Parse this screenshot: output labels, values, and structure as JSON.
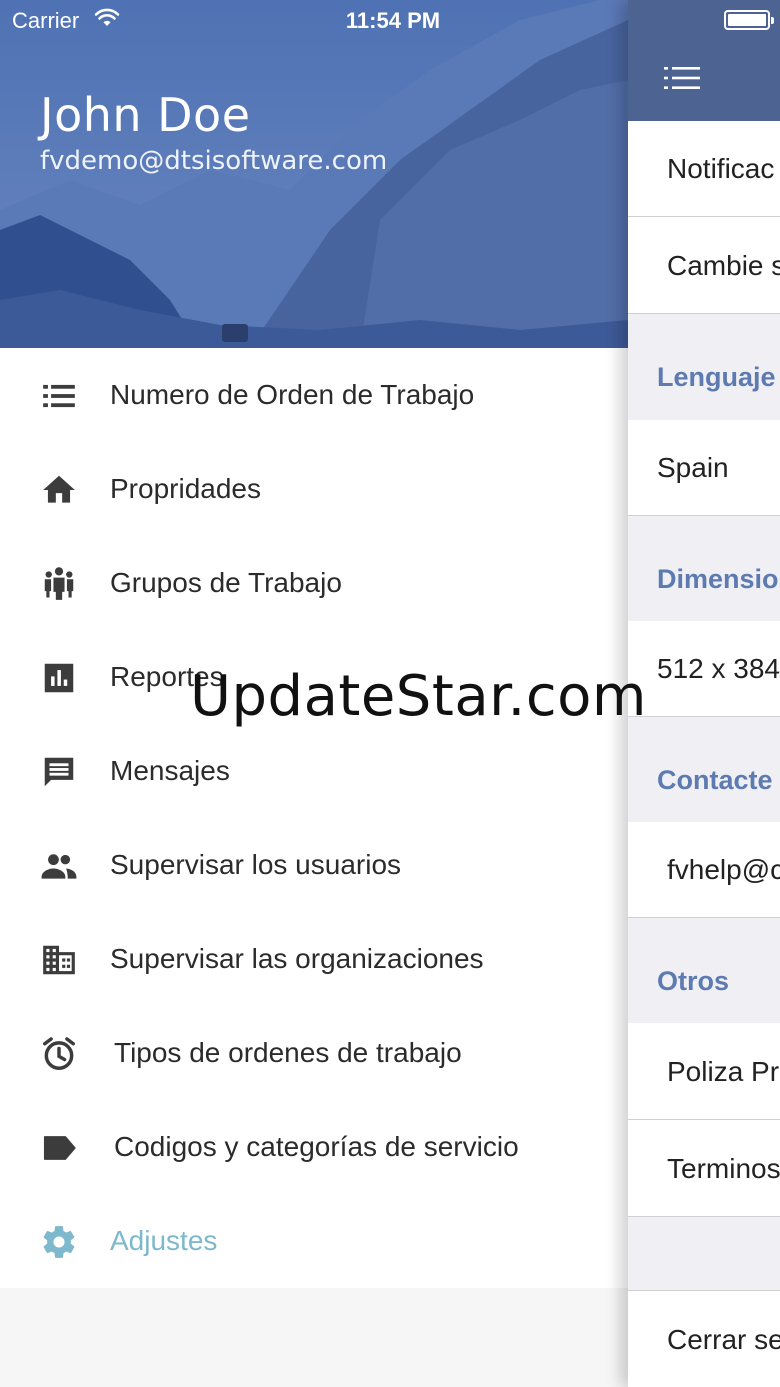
{
  "status_bar": {
    "carrier": "Carrier",
    "time": "11:54 PM"
  },
  "drawer": {
    "user": {
      "name": "John Doe",
      "email": "fvdemo@dtsisoftware.com"
    },
    "items": [
      {
        "label": "Numero de Orden de Trabajo",
        "icon": "list-icon"
      },
      {
        "label": "Propridades",
        "icon": "home-icon"
      },
      {
        "label": "Grupos de Trabajo",
        "icon": "group-icon"
      },
      {
        "label": "Reportes",
        "icon": "chart-icon"
      },
      {
        "label": "Mensajes",
        "icon": "message-icon"
      },
      {
        "label": "Supervisar los usuarios",
        "icon": "users-icon"
      },
      {
        "label": "Supervisar las organizaciones",
        "icon": "building-icon"
      },
      {
        "label": "Tipos de ordenes de trabajo",
        "icon": "alarm-icon"
      },
      {
        "label": "Codigos y categorías de servicio",
        "icon": "label-icon"
      },
      {
        "label": "Adjustes",
        "icon": "gear-icon",
        "active": true
      }
    ],
    "active_color": "#7db8cc"
  },
  "settings_panel": {
    "menu_icon": "menu-icon",
    "rows": {
      "notifications": "Notificac",
      "change": "Cambie s",
      "language_value": "Spain",
      "dimension_value": "512 x 384",
      "contact_value": "fvhelp@c",
      "privacy": "Poliza Pri",
      "terms": "Terminos",
      "logout": "Cerrar se"
    },
    "sections": {
      "language": "Lenguaje",
      "dimension": "Dimensio",
      "contact": "Contacte",
      "other": "Otros"
    },
    "nav_color": "#4d6391",
    "section_color": "#5d7bb0"
  },
  "watermark": "UpdateStar.com"
}
